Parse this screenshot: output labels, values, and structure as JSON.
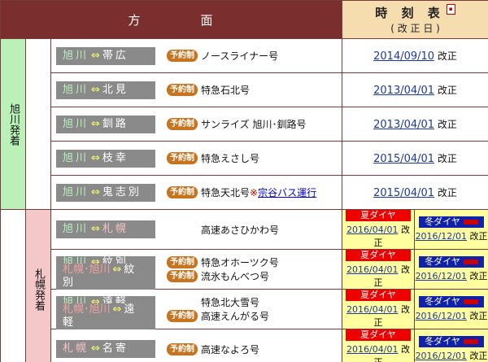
{
  "header": {
    "direction_a": "方",
    "direction_b": "面",
    "timetable_title": "時 刻 表",
    "timetable_pdf_icon": "pdf-icon",
    "timetable_sub": "( 改 正 日 )"
  },
  "sections": {
    "asahikawa": "旭川発着",
    "sapporo": "札幌発着"
  },
  "routes": [
    {
      "from": "旭川",
      "arrow": "⇔",
      "to": "帯広",
      "reserve": "予約制",
      "train": "ノースライナー号",
      "date": "2014/09/10",
      "suffix": "改正"
    },
    {
      "from": "旭川",
      "arrow": "⇔",
      "to": "北見",
      "reserve": "予約制",
      "train": "特急石北号",
      "date": "2013/04/01",
      "suffix": "改正"
    },
    {
      "from": "旭川",
      "arrow": "⇔",
      "to": "釧路",
      "reserve": "予約制",
      "train": "サンライズ 旭川･釧路号",
      "date": "2013/04/01",
      "suffix": "改正"
    },
    {
      "from": "旭川",
      "arrow": "⇔",
      "to": "枝幸",
      "reserve": "予約制",
      "train": "特急えさし号",
      "date": "2015/04/01",
      "suffix": "改正"
    },
    {
      "from": "旭川",
      "arrow": "⇔",
      "to": "鬼志別",
      "reserve": "予約制",
      "train": "特急天北号",
      "note": "※",
      "note_link": "宗谷バス運行",
      "date": "2015/04/01",
      "suffix": "改正"
    }
  ],
  "sapporo_routes": [
    {
      "from": "旭川",
      "arrow": "⇔",
      "to": "札幌",
      "train": "高速あさひかわ号"
    },
    {
      "from": "旭川",
      "arrow": "⇔",
      "to": "紋別",
      "from2": "札幌･旭川",
      "arrow2": "⇔",
      "to2": "紋別",
      "reserve": "予約制",
      "train": "特急オホーツク号",
      "reserve2": "予約制",
      "train2": "流氷もんべつ号"
    },
    {
      "from": "旭川",
      "arrow": "⇔",
      "to": "遠軽",
      "from2": "札幌･旭川",
      "arrow2": "⇔",
      "to2": "遠軽",
      "train": "特急北大雪号",
      "reserve2": "予約制",
      "train2": "高速えんがる号"
    },
    {
      "from": "札幌",
      "arrow": "⇔",
      "to": "名寄",
      "reserve": "予約制",
      "train": "高速なよろ号"
    }
  ],
  "season": {
    "summer_label": "夏ダイヤ",
    "winter_label": "冬ダイヤ",
    "summer_date": "2016/04/01",
    "winter_date": "2016/12/01",
    "suffix": "改正"
  }
}
